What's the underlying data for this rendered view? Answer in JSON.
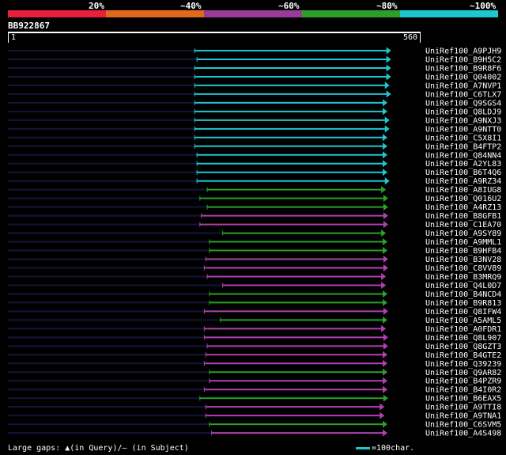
{
  "legend": {
    "labels": [
      "20%",
      "~40%",
      "~60%",
      "~80%",
      "~100%"
    ],
    "colors": [
      "#e8203c",
      "#e06a1a",
      "#9a3a9a",
      "#2aa02a",
      "#1ec6d0"
    ]
  },
  "query": {
    "id": "BB922867",
    "start": "1",
    "end": "560"
  },
  "colors": {
    "teal": "#1ec6d0",
    "green": "#2aa02a",
    "purple": "#b040b0",
    "navy": "#14143c"
  },
  "hits": [
    {
      "label": "UniRef100_A9PJH9",
      "color": "teal",
      "start": 255,
      "end": 522
    },
    {
      "label": "UniRef100_B9H5C2",
      "color": "teal",
      "start": 258,
      "end": 522
    },
    {
      "label": "UniRef100_B9R8F6",
      "color": "teal",
      "start": 255,
      "end": 522
    },
    {
      "label": "UniRef100_Q04002",
      "color": "teal",
      "start": 255,
      "end": 522
    },
    {
      "label": "UniRef100_A7NVP1",
      "color": "teal",
      "start": 255,
      "end": 520
    },
    {
      "label": "UniRef100_C6TLX7",
      "color": "teal",
      "start": 255,
      "end": 522
    },
    {
      "label": "UniRef100_Q9SGS4",
      "color": "teal",
      "start": 255,
      "end": 517
    },
    {
      "label": "UniRef100_Q8LDJ9",
      "color": "teal",
      "start": 255,
      "end": 517
    },
    {
      "label": "UniRef100_A9NXJ3",
      "color": "teal",
      "start": 255,
      "end": 520
    },
    {
      "label": "UniRef100_A9NTT0",
      "color": "teal",
      "start": 255,
      "end": 520
    },
    {
      "label": "UniRef100_C5X8I1",
      "color": "teal",
      "start": 255,
      "end": 517
    },
    {
      "label": "UniRef100_B4FTP2",
      "color": "teal",
      "start": 255,
      "end": 517
    },
    {
      "label": "UniRef100_Q84NN4",
      "color": "teal",
      "start": 258,
      "end": 517
    },
    {
      "label": "UniRef100_A2YL83",
      "color": "teal",
      "start": 258,
      "end": 517
    },
    {
      "label": "UniRef100_B6T4Q6",
      "color": "teal",
      "start": 258,
      "end": 517
    },
    {
      "label": "UniRef100_A9RZ34",
      "color": "teal",
      "start": 258,
      "end": 520
    },
    {
      "label": "UniRef100_A8IUG8",
      "color": "green",
      "start": 272,
      "end": 515
    },
    {
      "label": "UniRef100_Q016U2",
      "color": "green",
      "start": 262,
      "end": 518
    },
    {
      "label": "UniRef100_A4RZ13",
      "color": "green",
      "start": 272,
      "end": 518
    },
    {
      "label": "UniRef100_B8GFB1",
      "color": "purple",
      "start": 264,
      "end": 518
    },
    {
      "label": "UniRef100_C1EA70",
      "color": "purple",
      "start": 262,
      "end": 518
    },
    {
      "label": "UniRef100_A9SY89",
      "color": "green",
      "start": 293,
      "end": 515
    },
    {
      "label": "UniRef100_A9MML1",
      "color": "green",
      "start": 275,
      "end": 517
    },
    {
      "label": "UniRef100_B9HFB4",
      "color": "green",
      "start": 275,
      "end": 517
    },
    {
      "label": "UniRef100_B3NV28",
      "color": "purple",
      "start": 270,
      "end": 518
    },
    {
      "label": "UniRef100_C8VV89",
      "color": "purple",
      "start": 268,
      "end": 518
    },
    {
      "label": "UniRef100_B3MRQ9",
      "color": "purple",
      "start": 272,
      "end": 515
    },
    {
      "label": "UniRef100_Q4L0D7",
      "color": "purple",
      "start": 293,
      "end": 515
    },
    {
      "label": "UniRef100_B4NCD4",
      "color": "green",
      "start": 275,
      "end": 517
    },
    {
      "label": "UniRef100_B9R813",
      "color": "green",
      "start": 275,
      "end": 517
    },
    {
      "label": "UniRef100_Q8IFW4",
      "color": "purple",
      "start": 268,
      "end": 518
    },
    {
      "label": "UniRef100_A5AML5",
      "color": "green",
      "start": 290,
      "end": 517
    },
    {
      "label": "UniRef100_A0FDR1",
      "color": "purple",
      "start": 268,
      "end": 515
    },
    {
      "label": "UniRef100_Q8L907",
      "color": "purple",
      "start": 268,
      "end": 518
    },
    {
      "label": "UniRef100_Q8GZT3",
      "color": "purple",
      "start": 272,
      "end": 518
    },
    {
      "label": "UniRef100_B4GTE2",
      "color": "purple",
      "start": 270,
      "end": 517
    },
    {
      "label": "UniRef100_Q39239",
      "color": "purple",
      "start": 268,
      "end": 517
    },
    {
      "label": "UniRef100_Q9AR82",
      "color": "green",
      "start": 275,
      "end": 517
    },
    {
      "label": "UniRef100_B4PZR9",
      "color": "purple",
      "start": 275,
      "end": 517
    },
    {
      "label": "UniRef100_B4I0R2",
      "color": "purple",
      "start": 268,
      "end": 517
    },
    {
      "label": "UniRef100_B6EAX5",
      "color": "green",
      "start": 262,
      "end": 518
    },
    {
      "label": "UniRef100_A9TTI8",
      "color": "purple",
      "start": 270,
      "end": 513
    },
    {
      "label": "UniRef100_A9TNA1",
      "color": "purple",
      "start": 270,
      "end": 513
    },
    {
      "label": "UniRef100_C6SVM5",
      "color": "green",
      "start": 275,
      "end": 517
    },
    {
      "label": "UniRef100_A4S498",
      "color": "purple",
      "start": 278,
      "end": 517
    }
  ],
  "footer": {
    "gaps_text": "Large gaps: ▲(in Query)/– (in Subject)",
    "scale_text": "=100char."
  }
}
